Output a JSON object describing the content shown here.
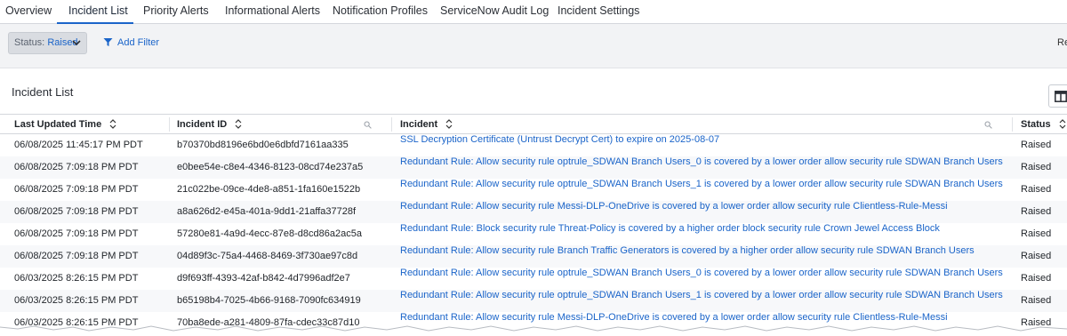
{
  "tabs": [
    {
      "label": "Overview",
      "active": false
    },
    {
      "label": "Incident List",
      "active": true
    },
    {
      "label": "Priority Alerts",
      "active": false
    },
    {
      "label": "Informational Alerts",
      "active": false
    },
    {
      "label": "Notification Profiles",
      "active": false
    },
    {
      "label": "ServiceNow Audit Log",
      "active": false
    },
    {
      "label": "Incident Settings",
      "active": false
    }
  ],
  "filter_bar": {
    "status_key": "Status:",
    "status_value": "Raised",
    "add_filter_label": "Add Filter",
    "right_text": "Re"
  },
  "section": {
    "title": "Incident List"
  },
  "table": {
    "columns": [
      {
        "label": "Last Updated Time",
        "searchable": false
      },
      {
        "label": "Incident ID",
        "searchable": true
      },
      {
        "label": "Incident",
        "searchable": true
      },
      {
        "label": "Status",
        "searchable": false
      }
    ],
    "rows": [
      {
        "time": "06/08/2025 11:45:17 PM PDT",
        "id": "b70370bd8196e6bd0e6dbfd7161aa335",
        "incident": "SSL Decryption Certificate (Untrust Decrypt Cert) to expire on 2025-08-07",
        "status": "Raised"
      },
      {
        "time": "06/08/2025 7:09:18 PM PDT",
        "id": "e0bee54e-c8e4-4346-8123-08cd74e237a5",
        "incident": "Redundant Rule: Allow security rule optrule_SDWAN Branch Users_0 is covered by a lower order allow security rule SDWAN Branch Users",
        "status": "Raised"
      },
      {
        "time": "06/08/2025 7:09:18 PM PDT",
        "id": "21c022be-09ce-4de8-a851-1fa160e1522b",
        "incident": "Redundant Rule: Allow security rule optrule_SDWAN Branch Users_1 is covered by a lower order allow security rule SDWAN Branch Users",
        "status": "Raised"
      },
      {
        "time": "06/08/2025 7:09:18 PM PDT",
        "id": "a8a626d2-e45a-401a-9dd1-21affa37728f",
        "incident": "Redundant Rule: Allow security rule Messi-DLP-OneDrive is covered by a lower order allow security rule Clientless-Rule-Messi",
        "status": "Raised"
      },
      {
        "time": "06/08/2025 7:09:18 PM PDT",
        "id": "57280e81-4a9d-4ecc-87e8-d8cd86a2ac5a",
        "incident": "Redundant Rule: Block security rule Threat-Policy is covered by a higher order block security rule Crown Jewel Access Block",
        "status": "Raised"
      },
      {
        "time": "06/08/2025 7:09:18 PM PDT",
        "id": "04d89f3c-75a4-4468-8469-3f730ae97c8d",
        "incident": "Redundant Rule: Allow security rule Branch Traffic Generators is covered by a higher order allow security rule SDWAN Branch Users",
        "status": "Raised"
      },
      {
        "time": "06/03/2025 8:26:15 PM PDT",
        "id": "d9f693ff-4393-42af-b842-4d7996adf2e7",
        "incident": "Redundant Rule: Allow security rule optrule_SDWAN Branch Users_0 is covered by a lower order allow security rule SDWAN Branch Users",
        "status": "Raised"
      },
      {
        "time": "06/03/2025 8:26:15 PM PDT",
        "id": "b65198b4-7025-4b66-9168-7090fc634919",
        "incident": "Redundant Rule: Allow security rule optrule_SDWAN Branch Users_1 is covered by a lower order allow security rule SDWAN Branch Users",
        "status": "Raised"
      },
      {
        "time": "06/03/2025 8:26:15 PM PDT",
        "id": "70ba8ede-a281-4809-87fa-cdec33c87d10",
        "incident": "Redundant Rule: Allow security rule Messi-DLP-OneDrive is covered by a lower order allow security rule Clientless-Rule-Messi",
        "status": "Raised"
      }
    ]
  },
  "colors": {
    "accent": "#1a64c9",
    "link": "#1a64c9",
    "filter_bg": "#f2f3f5"
  }
}
